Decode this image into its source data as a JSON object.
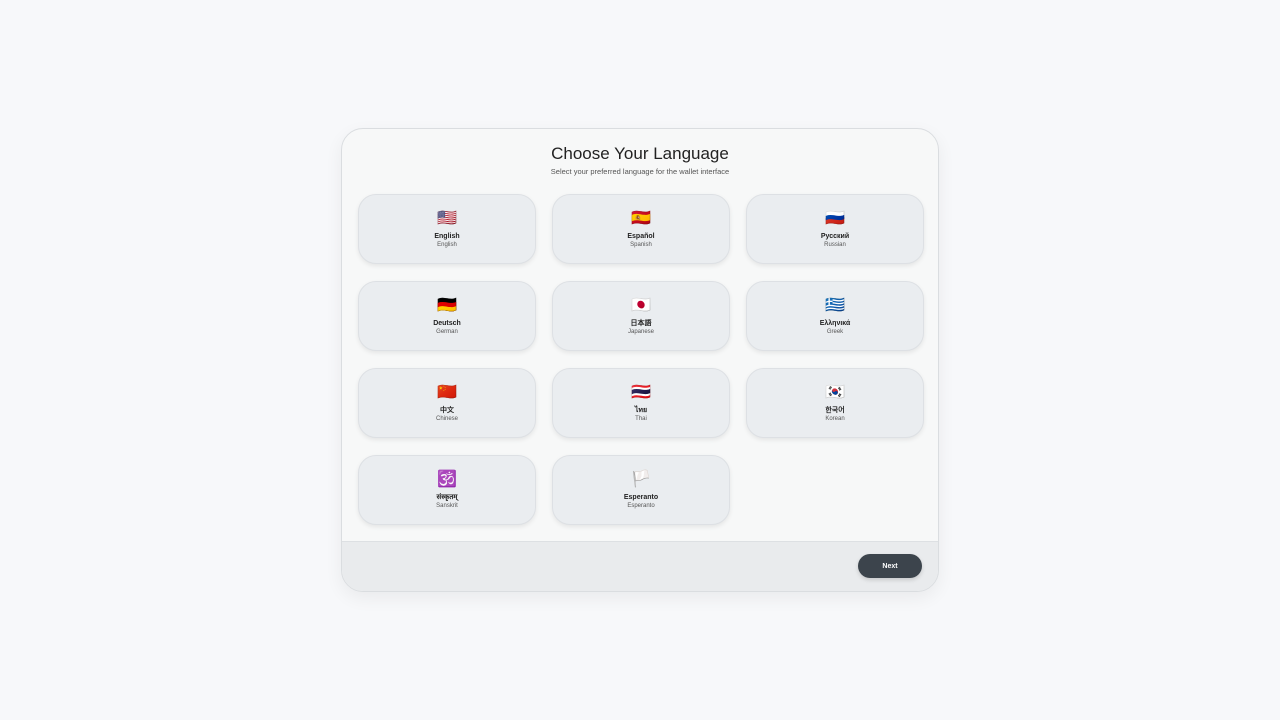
{
  "header": {
    "title": "Choose Your Language",
    "subtitle": "Select your preferred language for the wallet interface"
  },
  "languages": [
    {
      "flag": "🇺🇸",
      "icon": "us-flag-icon",
      "native": "English",
      "english": "English"
    },
    {
      "flag": "🇪🇸",
      "icon": "spain-flag-icon",
      "native": "Español",
      "english": "Spanish"
    },
    {
      "flag": "🇷🇺",
      "icon": "russia-flag-icon",
      "native": "Русский",
      "english": "Russian"
    },
    {
      "flag": "🇩🇪",
      "icon": "germany-flag-icon",
      "native": "Deutsch",
      "english": "German"
    },
    {
      "flag": "🇯🇵",
      "icon": "japan-flag-icon",
      "native": "日本語",
      "english": "Japanese"
    },
    {
      "flag": "🇬🇷",
      "icon": "greece-flag-icon",
      "native": "Ελληνικά",
      "english": "Greek"
    },
    {
      "flag": "🇨🇳",
      "icon": "china-flag-icon",
      "native": "中文",
      "english": "Chinese"
    },
    {
      "flag": "🇹🇭",
      "icon": "thailand-flag-icon",
      "native": "ไทย",
      "english": "Thai"
    },
    {
      "flag": "🇰🇷",
      "icon": "korea-flag-icon",
      "native": "한국어",
      "english": "Korean"
    },
    {
      "flag": "🕉️",
      "icon": "om-icon",
      "native": "संस्कृतम्",
      "english": "Sanskrit"
    },
    {
      "flag": "🏳️",
      "icon": "white-flag-icon",
      "native": "Esperanto",
      "english": "Esperanto"
    }
  ],
  "footer": {
    "next_label": "Next"
  }
}
